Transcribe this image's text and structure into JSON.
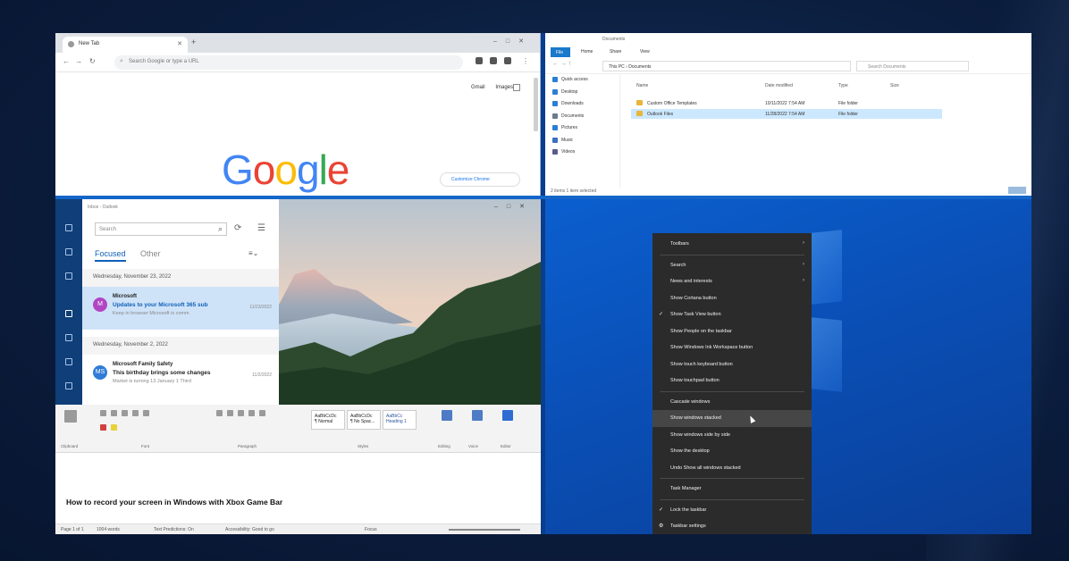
{
  "chrome": {
    "tab_title": "New Tab",
    "omnibox_placeholder": "Search Google or type a URL",
    "links": [
      "Gmail",
      "Images"
    ],
    "logo_letters": [
      {
        "ch": "G",
        "color": "#4285F4"
      },
      {
        "ch": "o",
        "color": "#EA4335"
      },
      {
        "ch": "o",
        "color": "#FBBC05"
      },
      {
        "ch": "g",
        "color": "#4285F4"
      },
      {
        "ch": "l",
        "color": "#34A853"
      },
      {
        "ch": "e",
        "color": "#EA4335"
      }
    ],
    "customize_label": "Customize Chrome"
  },
  "explorer": {
    "title": "Documents",
    "ribbon_tabs": [
      "File",
      "Home",
      "Share",
      "View"
    ],
    "address": "This PC › Documents",
    "search_placeholder": "Search Documents",
    "nav_items": [
      {
        "label": "Quick access",
        "color": "#2a7fd4"
      },
      {
        "label": "Desktop",
        "color": "#2a7fd4"
      },
      {
        "label": "Downloads",
        "color": "#2a7fd4"
      },
      {
        "label": "Documents",
        "color": "#6b7a8f"
      },
      {
        "label": "Pictures",
        "color": "#2a7fd4"
      },
      {
        "label": "Music",
        "color": "#3a6fc1"
      },
      {
        "label": "Videos",
        "color": "#5a5a8f"
      }
    ],
    "columns": [
      "Name",
      "Date modified",
      "Type",
      "Size"
    ],
    "files": [
      {
        "name": "Custom Office Templates",
        "date": "10/11/2022 7:54 AM",
        "type": "File folder",
        "size": ""
      },
      {
        "name": "Outlook Files",
        "date": "11/28/2022 7:54 AM",
        "type": "File folder",
        "size": ""
      }
    ],
    "status": "2 items   1 item selected"
  },
  "outlook": {
    "app_title": "Inbox - Outlook",
    "search_placeholder": "Search",
    "tab_focused": "Focused",
    "tab_other": "Other",
    "filter_icon": "filter-icon",
    "groups": [
      {
        "date": "Wednesday, November 23, 2022",
        "mail": {
          "initials": "M",
          "avatar_color": "#b146c2",
          "from": "Microsoft",
          "subject": "Updates to your Microsoft 365 sub",
          "preview": "Keep in browser Microsoft is comm",
          "time": "11/23/2022",
          "selected": true
        }
      },
      {
        "date": "Wednesday, November 2, 2022",
        "mail": {
          "initials": "MS",
          "avatar_color": "#2f7bd6",
          "from": "Microsoft Family Safety",
          "subject": "This birthday brings some changes",
          "preview": "Market is turning 13 January 1 Third",
          "time": "11/2/2022",
          "selected": false
        }
      }
    ]
  },
  "word": {
    "groups": [
      "Clipboard",
      "Font",
      "Paragraph",
      "Styles",
      "Editing",
      "Voice",
      "Editor"
    ],
    "styles": [
      "AaBbCcDc",
      "AaBbCcDc",
      "AaBbCc"
    ],
    "style_names": [
      "¶ Normal",
      "¶ No Spac...",
      "Heading 1"
    ],
    "heading": "How to record your screen in Windows with Xbox Game Bar",
    "status": [
      "Page 1 of 1",
      "1004 words",
      "Text Predictions: On",
      "Accessibility: Good to go",
      "Focus"
    ]
  },
  "context_menu": {
    "items": [
      {
        "label": "Toolbars",
        "submenu": true
      },
      {
        "sep": true
      },
      {
        "label": "Search",
        "submenu": true
      },
      {
        "label": "News and interests",
        "submenu": true
      },
      {
        "label": "Show Cortana button"
      },
      {
        "label": "Show Task View button",
        "checked": true
      },
      {
        "label": "Show People on the taskbar"
      },
      {
        "label": "Show Windows Ink Workspace button"
      },
      {
        "label": "Show touch keyboard button"
      },
      {
        "label": "Show touchpad button"
      },
      {
        "sep": true
      },
      {
        "label": "Cascade windows"
      },
      {
        "label": "Show windows stacked",
        "highlighted": true
      },
      {
        "label": "Show windows side by side"
      },
      {
        "label": "Show the desktop"
      },
      {
        "label": "Undo Show all windows stacked"
      },
      {
        "sep": true
      },
      {
        "label": "Task Manager"
      },
      {
        "sep": true
      },
      {
        "label": "Lock the taskbar",
        "checked": true
      },
      {
        "label": "Taskbar settings",
        "icon": "gear-icon"
      }
    ]
  }
}
